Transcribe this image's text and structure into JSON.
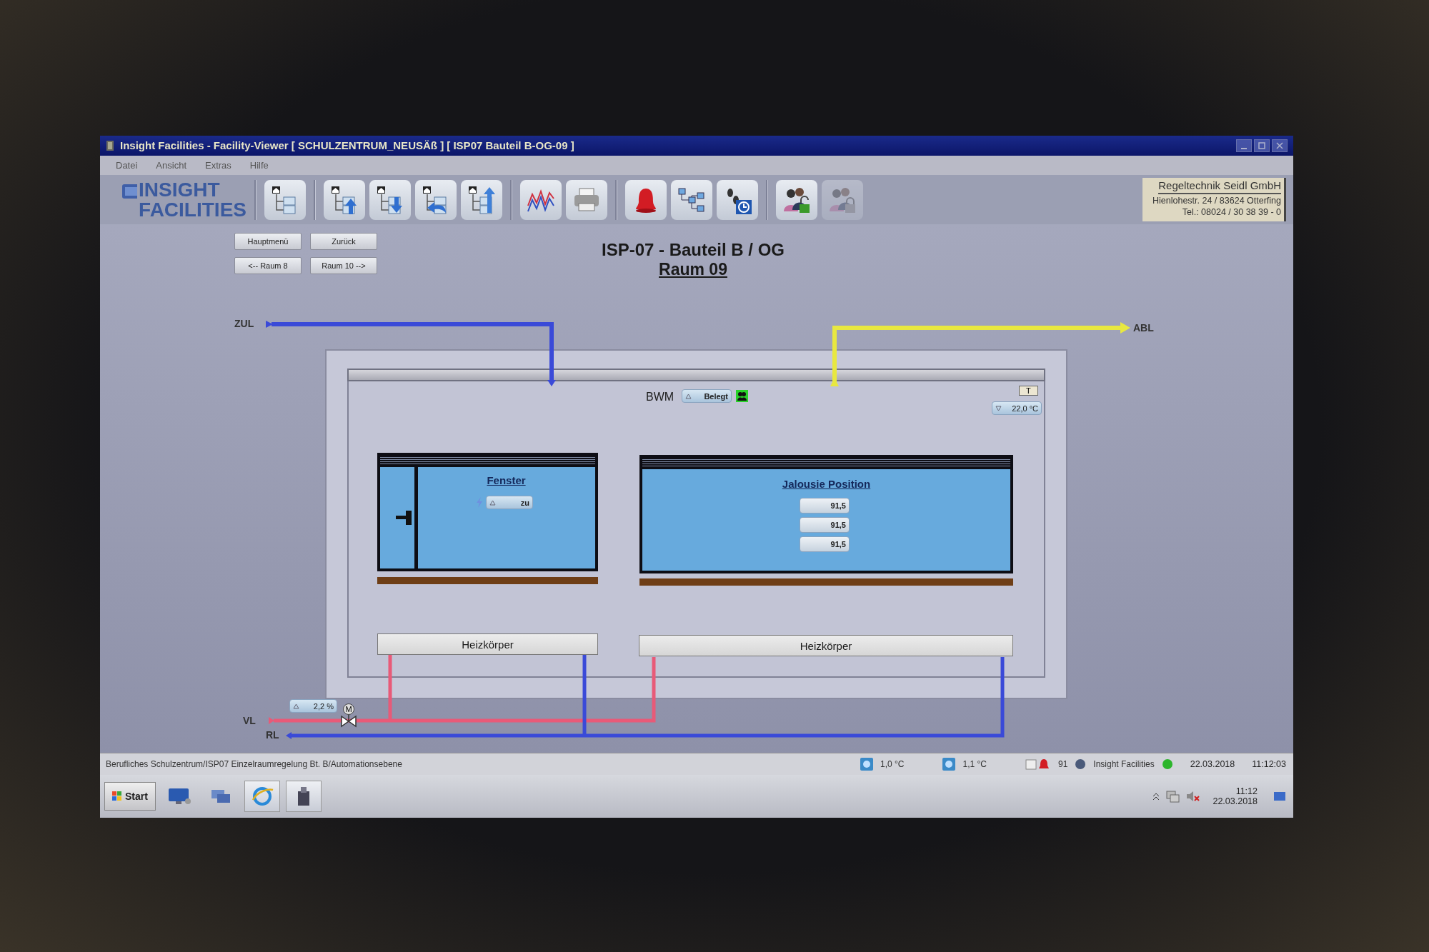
{
  "window": {
    "title": "Insight Facilities - Facility-Viewer [ SCHULZENTRUM_NEUSÄß ] [ ISP07 Bauteil B-OG-09 ]"
  },
  "menu": [
    "Datei",
    "Ansicht",
    "Extras",
    "Hilfe"
  ],
  "logo": {
    "line_1": "INSIGHT",
    "line_2": "FACILITIES"
  },
  "toolbar": [
    [
      {
        "kind": "tree",
        "disabled": false
      }
    ],
    [
      {
        "kind": "tree-up",
        "disabled": false
      },
      {
        "kind": "tree-down",
        "disabled": false
      },
      {
        "kind": "tree-back",
        "disabled": false
      },
      {
        "kind": "tree-return",
        "disabled": false
      }
    ],
    [
      {
        "kind": "chart",
        "disabled": false
      },
      {
        "kind": "printer",
        "disabled": false
      }
    ],
    [
      {
        "kind": "alarm-bell",
        "disabled": false
      },
      {
        "kind": "network",
        "disabled": false
      },
      {
        "kind": "schedule",
        "disabled": false
      }
    ],
    [
      {
        "kind": "users-unlock",
        "disabled": false
      },
      {
        "kind": "users-lock",
        "disabled": true
      }
    ]
  ],
  "company": {
    "name": "Regeltechnik Seidl GmbH",
    "address": "Hienlohestr. 24 / 83624 Otterfing",
    "phone": "Tel.: 08024 / 30 38 39 - 0"
  },
  "nav_buttons": [
    "Hauptmenü",
    "Zurück",
    "<-- Raum 8",
    "Raum 10 -->"
  ],
  "heading": {
    "title": "ISP-07 - Bauteil B / OG",
    "room": "Raum 09"
  },
  "diagram": {
    "supply_air": "ZUL",
    "exhaust_air": "ABL",
    "presence": {
      "label": "BWM",
      "value": "Belegt",
      "occupied": true
    },
    "temperature": {
      "label": "T",
      "value": "22,0 °C"
    },
    "window": {
      "title": "Fenster",
      "value": "zu"
    },
    "blind": {
      "title": "Jalousie Position",
      "values": [
        "91,5",
        "91,5",
        "91,5"
      ]
    },
    "radiators": [
      "Heizkörper",
      "Heizkörper"
    ],
    "valve": {
      "value": "2,2 %",
      "motor": "M"
    },
    "flow": "VL",
    "return": "RL"
  },
  "status_bar": {
    "path": "Berufliches Schulzentrum/ISP07 Einzelraumregelung Bt. B/Automationsebene",
    "readings": [
      "1,0 °C",
      "1,1 °C"
    ],
    "alarm_count": "91",
    "server": "Insight Facilities",
    "connected": true,
    "date": "22.03.2018",
    "time": "11:12:03"
  },
  "taskbar": {
    "start": "Start",
    "clock_time": "11:12",
    "clock_date": "22.03.2018"
  }
}
